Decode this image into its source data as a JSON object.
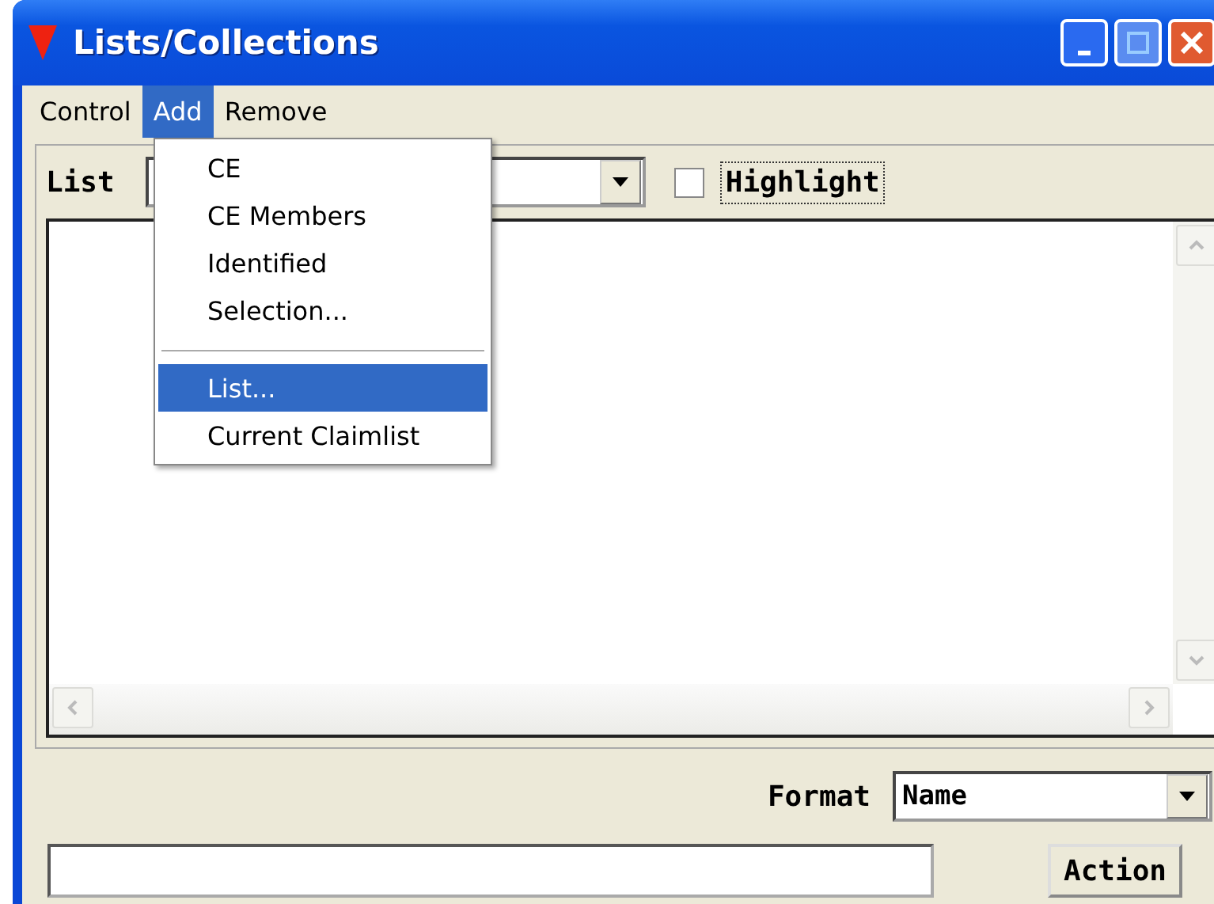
{
  "window": {
    "title": "Lists/Collections"
  },
  "menu_bar": [
    {
      "label": "Control",
      "selected": false
    },
    {
      "label": "Add",
      "selected": true
    },
    {
      "label": "Remove",
      "selected": false
    }
  ],
  "open_menu": [
    {
      "kind": "item",
      "label": "CE",
      "selected": false
    },
    {
      "kind": "item",
      "label": "CE Members",
      "selected": false
    },
    {
      "kind": "item",
      "label": "Identified",
      "selected": false
    },
    {
      "kind": "item",
      "label": "Selection...",
      "selected": false
    },
    {
      "kind": "separator"
    },
    {
      "kind": "item",
      "label": "List...",
      "selected": true
    },
    {
      "kind": "item",
      "label": "Current Claimlist",
      "selected": false
    }
  ],
  "list_row": {
    "label": "List",
    "highlight": {
      "label": "Highlight",
      "checked": false
    }
  },
  "format": {
    "label": "Format",
    "value": "Name"
  },
  "action_button": "Action"
}
